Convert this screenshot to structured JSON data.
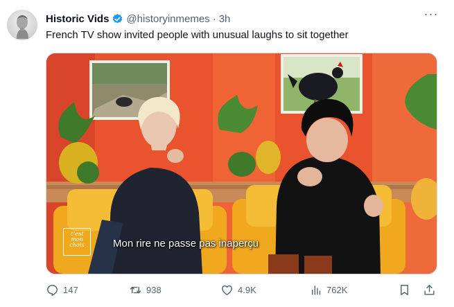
{
  "tweet": {
    "display_name": "Historic Vids",
    "handle": "@historyinmemes",
    "separator": "·",
    "time": "3h",
    "more_label": "···",
    "text": "French TV show invited people with unusual laughs to sit together",
    "verified_icon": "verified-badge-icon",
    "verified_color": "#1d9bf0"
  },
  "media": {
    "subtitle": "Mon rire ne passe pas inaperçu",
    "logo_lines": [
      "c'est",
      "mon",
      "choix"
    ],
    "background_color": "#e9542f",
    "chair_color": "#f0a91e"
  },
  "actions": {
    "replies": {
      "icon": "reply-icon",
      "count": "147"
    },
    "reposts": {
      "icon": "repost-icon",
      "count": "938"
    },
    "likes": {
      "icon": "heart-icon",
      "count": "4.9K"
    },
    "views": {
      "icon": "views-chart-icon",
      "count": "762K"
    },
    "bookmark": {
      "icon": "bookmark-icon"
    },
    "share": {
      "icon": "share-icon"
    }
  },
  "colors": {
    "text_primary": "#0f1419",
    "text_secondary": "#536471",
    "border": "#cfd9de"
  }
}
